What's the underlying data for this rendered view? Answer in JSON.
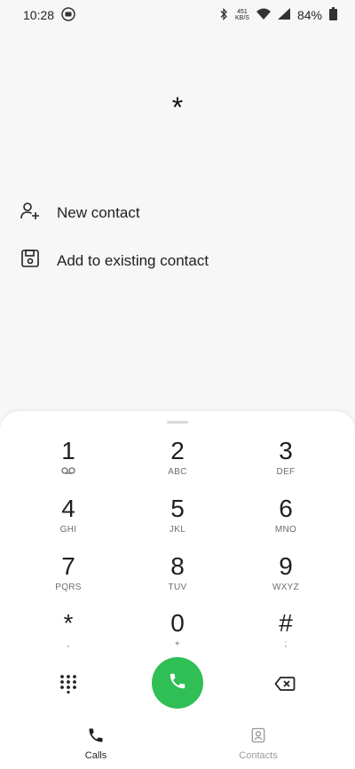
{
  "status": {
    "time": "10:28",
    "net_speed_value": "451",
    "net_speed_unit": "KB/S",
    "battery": "84%"
  },
  "dialed_number": "*",
  "actions": {
    "new_contact": "New contact",
    "add_existing": "Add to existing contact"
  },
  "keypad": {
    "k1": {
      "digit": "1",
      "letters": ""
    },
    "k2": {
      "digit": "2",
      "letters": "ABC"
    },
    "k3": {
      "digit": "3",
      "letters": "DEF"
    },
    "k4": {
      "digit": "4",
      "letters": "GHI"
    },
    "k5": {
      "digit": "5",
      "letters": "JKL"
    },
    "k6": {
      "digit": "6",
      "letters": "MNO"
    },
    "k7": {
      "digit": "7",
      "letters": "PQRS"
    },
    "k8": {
      "digit": "8",
      "letters": "TUV"
    },
    "k9": {
      "digit": "9",
      "letters": "WXYZ"
    },
    "kstar": {
      "digit": "*",
      "letters": ","
    },
    "k0": {
      "digit": "0",
      "letters": "+"
    },
    "khash": {
      "digit": "#",
      "letters": ";"
    }
  },
  "tabs": {
    "calls": "Calls",
    "contacts": "Contacts"
  },
  "colors": {
    "call_button": "#2fbf55",
    "background": "#f7f7f7"
  }
}
